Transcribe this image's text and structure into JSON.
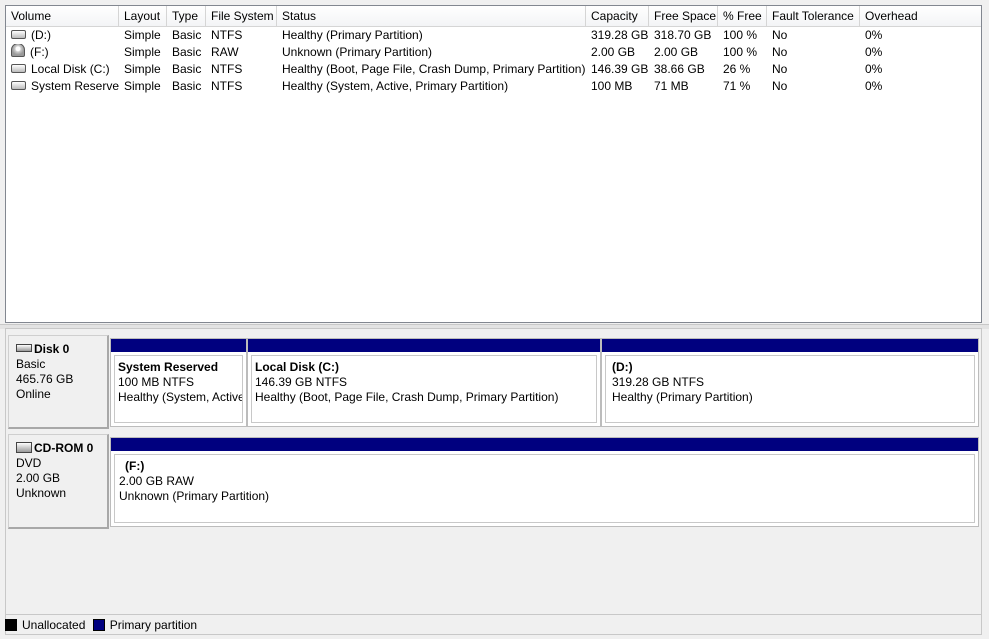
{
  "volume_list": {
    "columns": [
      "Volume",
      "Layout",
      "Type",
      "File System",
      "Status",
      "Capacity",
      "Free Space",
      "% Free",
      "Fault Tolerance",
      "Overhead"
    ],
    "rows": [
      {
        "icon": "drive-icon",
        "volume": "(D:)",
        "layout": "Simple",
        "type": "Basic",
        "fs": "NTFS",
        "status": "Healthy (Primary Partition)",
        "capacity": "319.28 GB",
        "free": "318.70 GB",
        "pct": "100 %",
        "fault": "No",
        "overhead": "0%"
      },
      {
        "icon": "cd-drive-icon",
        "volume": "(F:)",
        "layout": "Simple",
        "type": "Basic",
        "fs": "RAW",
        "status": "Unknown (Primary Partition)",
        "capacity": "2.00 GB",
        "free": "2.00 GB",
        "pct": "100 %",
        "fault": "No",
        "overhead": "0%"
      },
      {
        "icon": "drive-icon",
        "volume": "Local Disk (C:)",
        "layout": "Simple",
        "type": "Basic",
        "fs": "NTFS",
        "status": "Healthy (Boot, Page File, Crash Dump, Primary Partition)",
        "capacity": "146.39 GB",
        "free": "38.66 GB",
        "pct": "26 %",
        "fault": "No",
        "overhead": "0%"
      },
      {
        "icon": "drive-icon",
        "volume": "System Reserved",
        "layout": "Simple",
        "type": "Basic",
        "fs": "NTFS",
        "status": "Healthy (System, Active, Primary Partition)",
        "capacity": "100 MB",
        "free": "71 MB",
        "pct": "71 %",
        "fault": "No",
        "overhead": "0%"
      }
    ]
  },
  "disks": [
    {
      "name": "Disk 0",
      "type": "Basic",
      "size": "465.76 GB",
      "status": "Online",
      "icon": "hard-disk-icon",
      "partitions": [
        {
          "name": "System Reserved",
          "fs": "100 MB NTFS",
          "status": "Healthy (System, Active, Primary Partition)"
        },
        {
          "name": "Local Disk  (C:)",
          "fs": "146.39 GB NTFS",
          "status": "Healthy (Boot, Page File, Crash Dump, Primary Partition)"
        },
        {
          "name": "(D:)",
          "fs": "319.28 GB NTFS",
          "status": "Healthy (Primary Partition)"
        }
      ]
    },
    {
      "name": "CD-ROM 0",
      "type": "DVD",
      "size": "2.00 GB",
      "status": "Unknown",
      "icon": "cd-rom-icon",
      "partitions": [
        {
          "name": "(F:)",
          "fs": "2.00 GB RAW",
          "status": "Unknown (Primary Partition)"
        }
      ]
    }
  ],
  "legend": {
    "unallocated": {
      "label": "Unallocated",
      "color": "#000000"
    },
    "primary": {
      "label": "Primary partition",
      "color": "#00007f"
    }
  }
}
